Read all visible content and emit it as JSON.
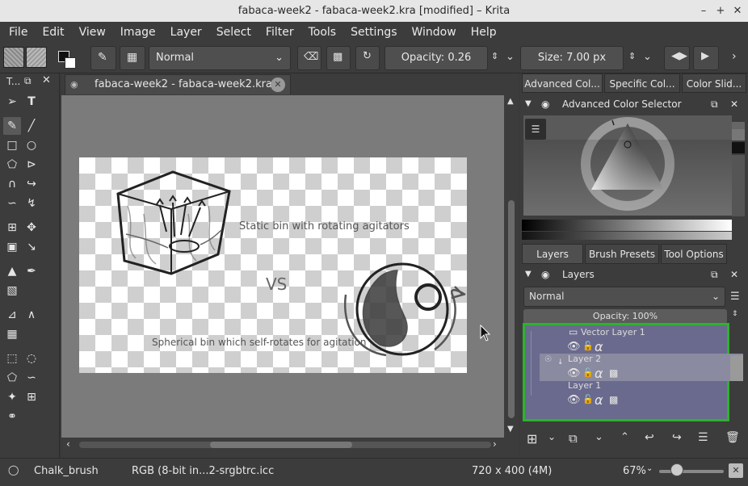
{
  "window": {
    "title": "fabaca-week2 - fabaca-week2.kra [modified] – Krita"
  },
  "menu": [
    "File",
    "Edit",
    "View",
    "Image",
    "Layer",
    "Select",
    "Filter",
    "Tools",
    "Settings",
    "Window",
    "Help"
  ],
  "toolbar": {
    "blend_mode": "Normal",
    "opacity_label": "Opacity:",
    "opacity_value": "0.26",
    "size_label": "Size:",
    "size_value": "7.00 px"
  },
  "toolbox": {
    "title": "T..."
  },
  "document": {
    "tab_label": "fabaca-week2 - fabaca-week2.kra",
    "canvas_text": {
      "static_label": "Static bin with rotating agitators",
      "vs_label": "VS",
      "spherical_label": "Spherical bin which self-rotates for agitation"
    }
  },
  "panels": {
    "top_tabs": [
      "Advanced Col...",
      "Specific Col...",
      "Color Slid..."
    ],
    "color_selector_title": "Advanced Color Selector",
    "bottom_tabs": [
      "Layers",
      "Brush Presets",
      "Tool Options"
    ],
    "layers_title": "Layers",
    "layers_blend_mode": "Normal",
    "layers_opacity": "Opacity:  100%",
    "layers": [
      {
        "name": "Vector Layer 1",
        "selected": false
      },
      {
        "name": "Layer 2",
        "selected": true
      },
      {
        "name": "Layer 1",
        "selected": false
      }
    ]
  },
  "status": {
    "brush": "Chalk_brush",
    "color_profile": "RGB (8-bit in...2-srgbtrc.icc",
    "image_size": "720 x 400 (4M)",
    "zoom": "67%",
    "zoom_fraction": 0.67
  },
  "colors": {
    "selection_highlight": "#2db22d",
    "layer_panel_bg": "#6a6a8e",
    "canvas_bg": "#7b7b7b"
  }
}
